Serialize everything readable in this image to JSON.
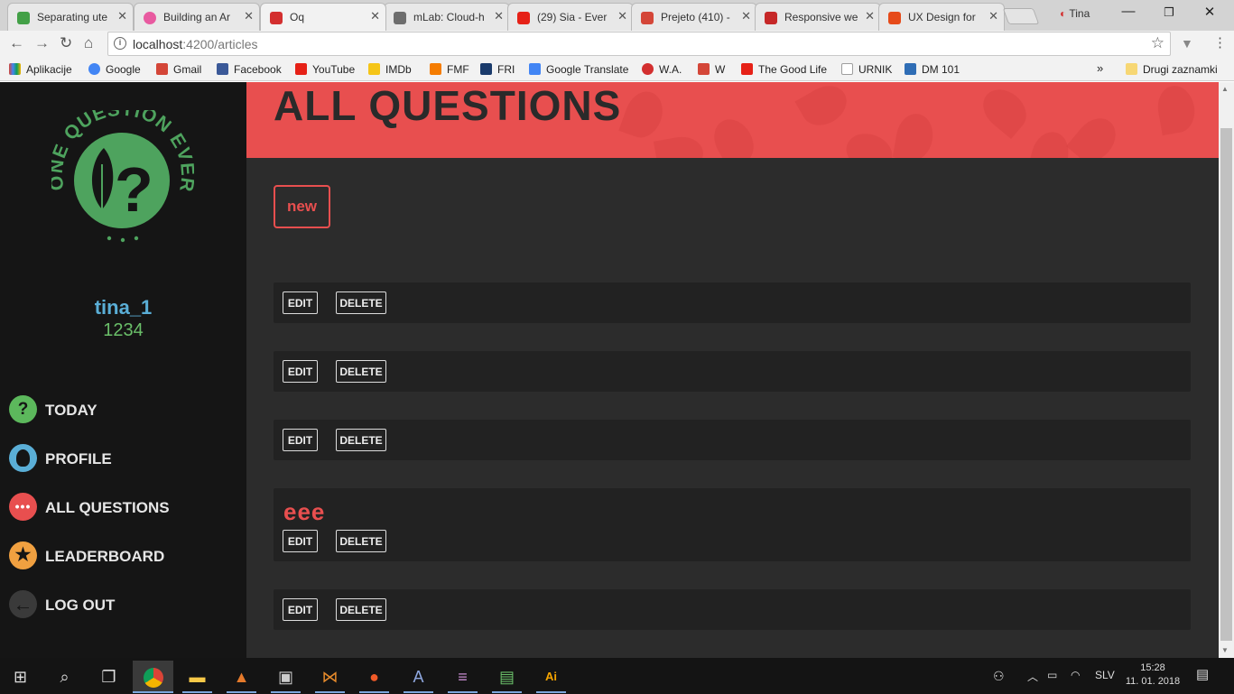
{
  "browser": {
    "tabs": [
      {
        "title": "Separating ute",
        "favicon_color": "#43a047"
      },
      {
        "title": "Building an Ar",
        "favicon_color": "#e85aa0"
      },
      {
        "title": "Oq",
        "favicon_color": "#d32f2f",
        "active": true
      },
      {
        "title": "mLab: Cloud-h",
        "favicon_color": "#6d6d6d"
      },
      {
        "title": "(29) Sia - Ever",
        "favicon_color": "#e62117"
      },
      {
        "title": "Prejeto (410) -",
        "favicon_color": "#d44638"
      },
      {
        "title": "Responsive we",
        "favicon_color": "#c62828"
      },
      {
        "title": "UX Design for",
        "favicon_color": "#e64a19"
      }
    ],
    "profile_name": "Tina",
    "url_host": "localhost",
    "url_rest": ":4200/articles",
    "bookmarks": [
      {
        "label": "Aplikacije",
        "icon_color": "#4285f4"
      },
      {
        "label": "Google",
        "icon_color": "#4285f4"
      },
      {
        "label": "Gmail",
        "icon_color": "#d44638"
      },
      {
        "label": "Facebook",
        "icon_color": "#3b5998"
      },
      {
        "label": "YouTube",
        "icon_color": "#e62117"
      },
      {
        "label": "IMDb",
        "icon_color": "#f5c518"
      },
      {
        "label": "FMF",
        "icon_color": "#f57c00"
      },
      {
        "label": "FRI",
        "icon_color": "#1a3a6b"
      },
      {
        "label": "Google Translate",
        "icon_color": "#4285f4"
      },
      {
        "label": "W.A.",
        "icon_color": "#d32f2f"
      },
      {
        "label": "W",
        "icon_color": "#d44638"
      },
      {
        "label": "The Good Life",
        "icon_color": "#e62117"
      },
      {
        "label": "URNIK",
        "icon_color": "#9e9e9e"
      },
      {
        "label": "DM 101",
        "icon_color": "#2f6db5"
      }
    ],
    "bookmarks_overflow": "»",
    "other_bookmarks": "Drugi zaznamki"
  },
  "page": {
    "title": "ALL QUESTIONS",
    "new_button": "new",
    "logo_text": "ONE QUESTION EVERY DAY",
    "user": {
      "name": "tina_1",
      "score": "1234"
    },
    "nav": [
      {
        "label": "TODAY",
        "icon": "question-icon",
        "color": "#5cb85c"
      },
      {
        "label": "PROFILE",
        "icon": "profile-icon",
        "color": "#5aaed6"
      },
      {
        "label": "ALL QUESTIONS",
        "icon": "more-icon",
        "color": "#e84f4f"
      },
      {
        "label": "LEADERBOARD",
        "icon": "star-icon",
        "color": "#f0a040"
      },
      {
        "label": "LOG OUT",
        "icon": "arrow-left-icon",
        "color": "#3a3a3a"
      }
    ],
    "questions": [
      {
        "text": "",
        "edit": "EDIT",
        "delete": "DELETE"
      },
      {
        "text": "",
        "edit": "EDIT",
        "delete": "DELETE"
      },
      {
        "text": "",
        "edit": "EDIT",
        "delete": "DELETE"
      },
      {
        "text": "eee",
        "edit": "EDIT",
        "delete": "DELETE"
      },
      {
        "text": "",
        "edit": "EDIT",
        "delete": "DELETE"
      }
    ],
    "accent_color": "#e84f4f"
  },
  "taskbar": {
    "language": "SLV",
    "time": "15:28",
    "date": "11. 01. 2018"
  }
}
